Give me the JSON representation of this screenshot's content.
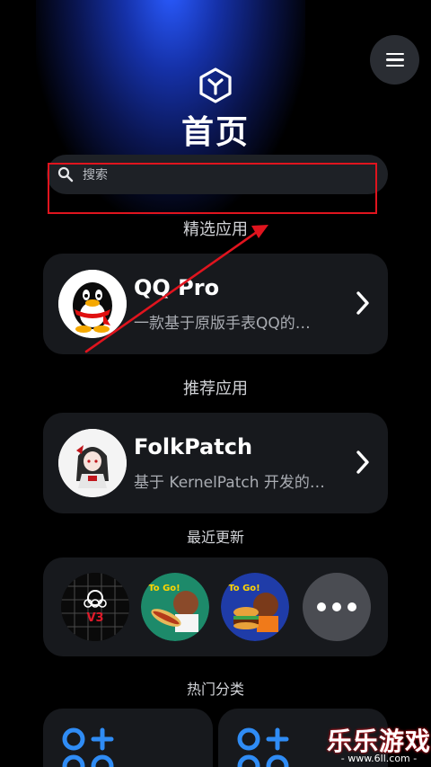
{
  "header": {
    "title": "首页",
    "menu_icon": "menu-icon",
    "logo_icon": "hexagon-y-logo-icon"
  },
  "search": {
    "placeholder": "搜索",
    "icon": "search-icon"
  },
  "featured": {
    "section_title": "精选应用",
    "app_name": "QQ Pro",
    "app_desc": "一款基于原版手表QQ的…",
    "icon": "qq-penguin-icon"
  },
  "recommended": {
    "section_title": "推荐应用",
    "app_name": "FolkPatch",
    "app_desc": "基于 KernelPatch 开发的…",
    "icon": "folkpatch-avatar-icon"
  },
  "recent": {
    "section_title": "最近更新",
    "items": [
      {
        "icon": "v3-gear-app-icon"
      },
      {
        "icon": "papas-hotdog-togo-icon"
      },
      {
        "icon": "papas-burger-togo-icon"
      },
      {
        "icon": "more-icon"
      }
    ],
    "togo_label": "To Go!",
    "v3_label": "V3"
  },
  "categories": {
    "section_title": "热门分类",
    "icon": "category-grid-plus-icon"
  },
  "annotation": {
    "color": "#e0141e"
  },
  "watermark": {
    "main": "乐乐游戏",
    "sub": "- www.6ll.com -"
  }
}
